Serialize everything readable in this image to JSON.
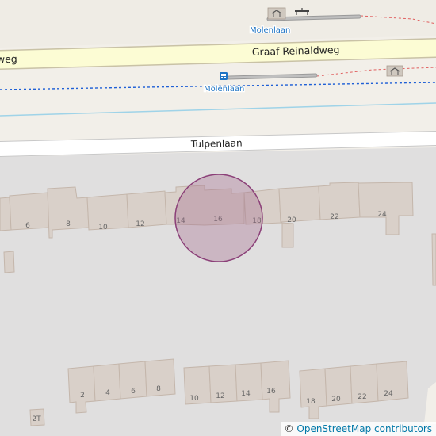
{
  "map": {
    "colors": {
      "residential": "#e0dfdf",
      "land": "#f2efe9",
      "building": "#d9d0c9",
      "building_stroke": "#c4b6ab",
      "primary_road": "#fcfcd4",
      "road_casing": "#c9c2a6",
      "minor_road": "#ffffff",
      "transit": "#1e5fd6",
      "water_line": "#9fd3e8",
      "stop_label": "#1e74c4",
      "marker_fill": "#a26b8c",
      "marker_stroke": "#8b3f78"
    },
    "streets": {
      "primary": "Graaf Reinaldweg",
      "primary_west": "weg",
      "minor": "Tulpenlaan"
    },
    "stops": {
      "north": "Molenlaan",
      "south": "Molenlaan"
    },
    "house_numbers_north_row": [
      "6",
      "8",
      "10",
      "12",
      "14",
      "16",
      "18",
      "20",
      "22",
      "24"
    ],
    "house_numbers_south_row_a": [
      "2",
      "4",
      "6",
      "8"
    ],
    "house_numbers_south_row_b": [
      "10",
      "12",
      "14",
      "16"
    ],
    "house_numbers_south_row_c": [
      "18",
      "20",
      "22",
      "24"
    ],
    "house_number_extra": "2T",
    "marker": {
      "highlighted_number": "16"
    },
    "icons": [
      "shelter-icon",
      "bench-icon",
      "bus-stop-icon"
    ]
  },
  "attribution": {
    "prefix": "©",
    "link_text": "OpenStreetMap contributors"
  }
}
